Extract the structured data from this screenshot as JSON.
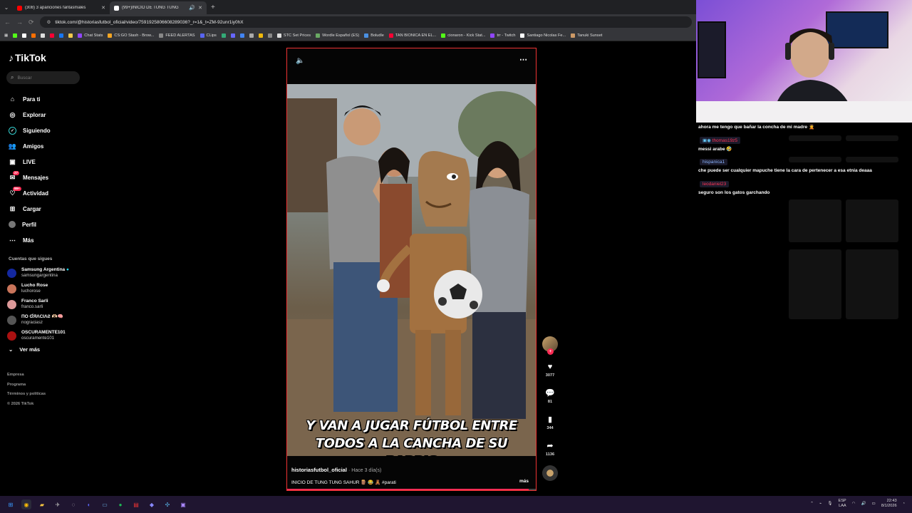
{
  "browser": {
    "tabs": [
      {
        "title": "(308) 3 apariciones fantasmales",
        "icon_color": "#ff0000"
      },
      {
        "title": "(99+)INICIO DE TUNG TUNG",
        "icon_color": "#ffffff"
      }
    ],
    "url": "tiktok.com/@historiasfutbol_oficial/video/7591925806608289036?_r=1&_t=ZM-92unr1iy0hX",
    "bookmarks": [
      "Chat Stats",
      "CS:GO Stash - Brow...",
      "FEED ALERTAS",
      "CLips",
      "STC Set Prices",
      "Wordle Español (ES)",
      "Boludle",
      "TAN BIONICA EN EL...",
      "cionaron - Kick Stat...",
      "trr - Twitch",
      "Santiago Nicolas Fe...",
      "Tanuki Sunset"
    ]
  },
  "tiktok": {
    "logo": "TikTok",
    "search_placeholder": "Buscar",
    "nav": [
      {
        "label": "Para ti",
        "icon": "home-icon"
      },
      {
        "label": "Explorar",
        "icon": "compass-icon"
      },
      {
        "label": "Siguiendo",
        "icon": "following-icon"
      },
      {
        "label": "Amigos",
        "icon": "friends-icon"
      },
      {
        "label": "LIVE",
        "icon": "live-icon"
      },
      {
        "label": "Mensajes",
        "icon": "messages-icon",
        "badge": "27"
      },
      {
        "label": "Actividad",
        "icon": "activity-icon",
        "badge": "99+"
      },
      {
        "label": "Cargar",
        "icon": "upload-icon"
      },
      {
        "label": "Perfil",
        "icon": "profile-icon"
      },
      {
        "label": "Más",
        "icon": "more-icon"
      }
    ],
    "following_title": "Cuentas que sigues",
    "following": [
      {
        "name": "Samsung Argentina",
        "handle": "samsungargentina",
        "color": "#1428a0"
      },
      {
        "name": "Lucho Rose",
        "handle": "luchorose",
        "color": "#c9745a"
      },
      {
        "name": "Franco Sarli",
        "handle": "franco.sarli",
        "color": "#d99"
      },
      {
        "name": "ПО ƓЯΛCIΛƧ 🫶🏻🧠",
        "handle": "nograciasz",
        "color": "#555"
      },
      {
        "name": "OSCURAMENTE101",
        "handle": "oscuramente101",
        "color": "#a11"
      }
    ],
    "ver_mas": "Ver más",
    "footer": [
      "Empresa",
      "Programa",
      "Términos y políticas",
      "© 2026 TikTok"
    ]
  },
  "video": {
    "caption": "Y VAN A JUGAR FÚTBOL ENTRE TODOS A LA CANCHA DE SU BARRIO",
    "author": "historiasfutbol_oficial",
    "time": "· Hace 3 día(s)",
    "description": "INICIO DE TUNG TUNG SAHUR 🪵 😂 🧸 #parati",
    "more": "más",
    "progress": 0.97,
    "likes": "3077",
    "comments": "81",
    "saves": "344",
    "shares": "1136"
  },
  "chat": [
    {
      "type": "msg",
      "text": "ahora me tengo que bañar la concha de mi madre 🤦"
    },
    {
      "type": "user",
      "text": "thomas19z5",
      "color": "#ff3355"
    },
    {
      "type": "msg",
      "text": "messi arabe 🤣"
    },
    {
      "type": "user",
      "text": "hispanica1",
      "color": "#8ab4ff"
    },
    {
      "type": "msg",
      "text": "che puede ser cualquier mapuche tiene la cara de pertenecer a esa etnia deaaa"
    },
    {
      "type": "user",
      "text": "leodaniel23",
      "color": "#ff3355"
    },
    {
      "type": "msg",
      "text": "seguro son los gatos garchando"
    }
  ],
  "tray": {
    "lang": "ESP",
    "layout": "LAA",
    "time": "22:43",
    "date": "8/1/2026"
  }
}
